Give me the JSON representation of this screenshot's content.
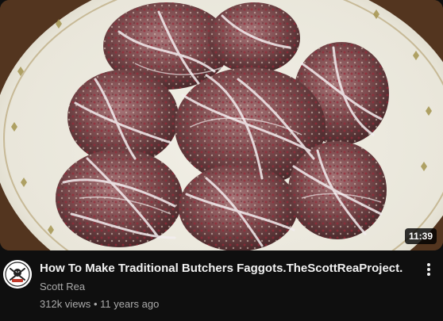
{
  "video": {
    "title": "How To Make Traditional Butchers Faggots.TheScottReaProject.",
    "channel": "Scott Rea",
    "views": "312k views",
    "separator": "•",
    "age": "11 years ago",
    "duration": "11:39"
  },
  "icons": {
    "avatar": "channel-avatar-icon",
    "more": "more-vert-icon"
  },
  "colors": {
    "background": "#0f0f0f",
    "primary_text": "#f1f1f1",
    "secondary_text": "#aaaaaa"
  }
}
